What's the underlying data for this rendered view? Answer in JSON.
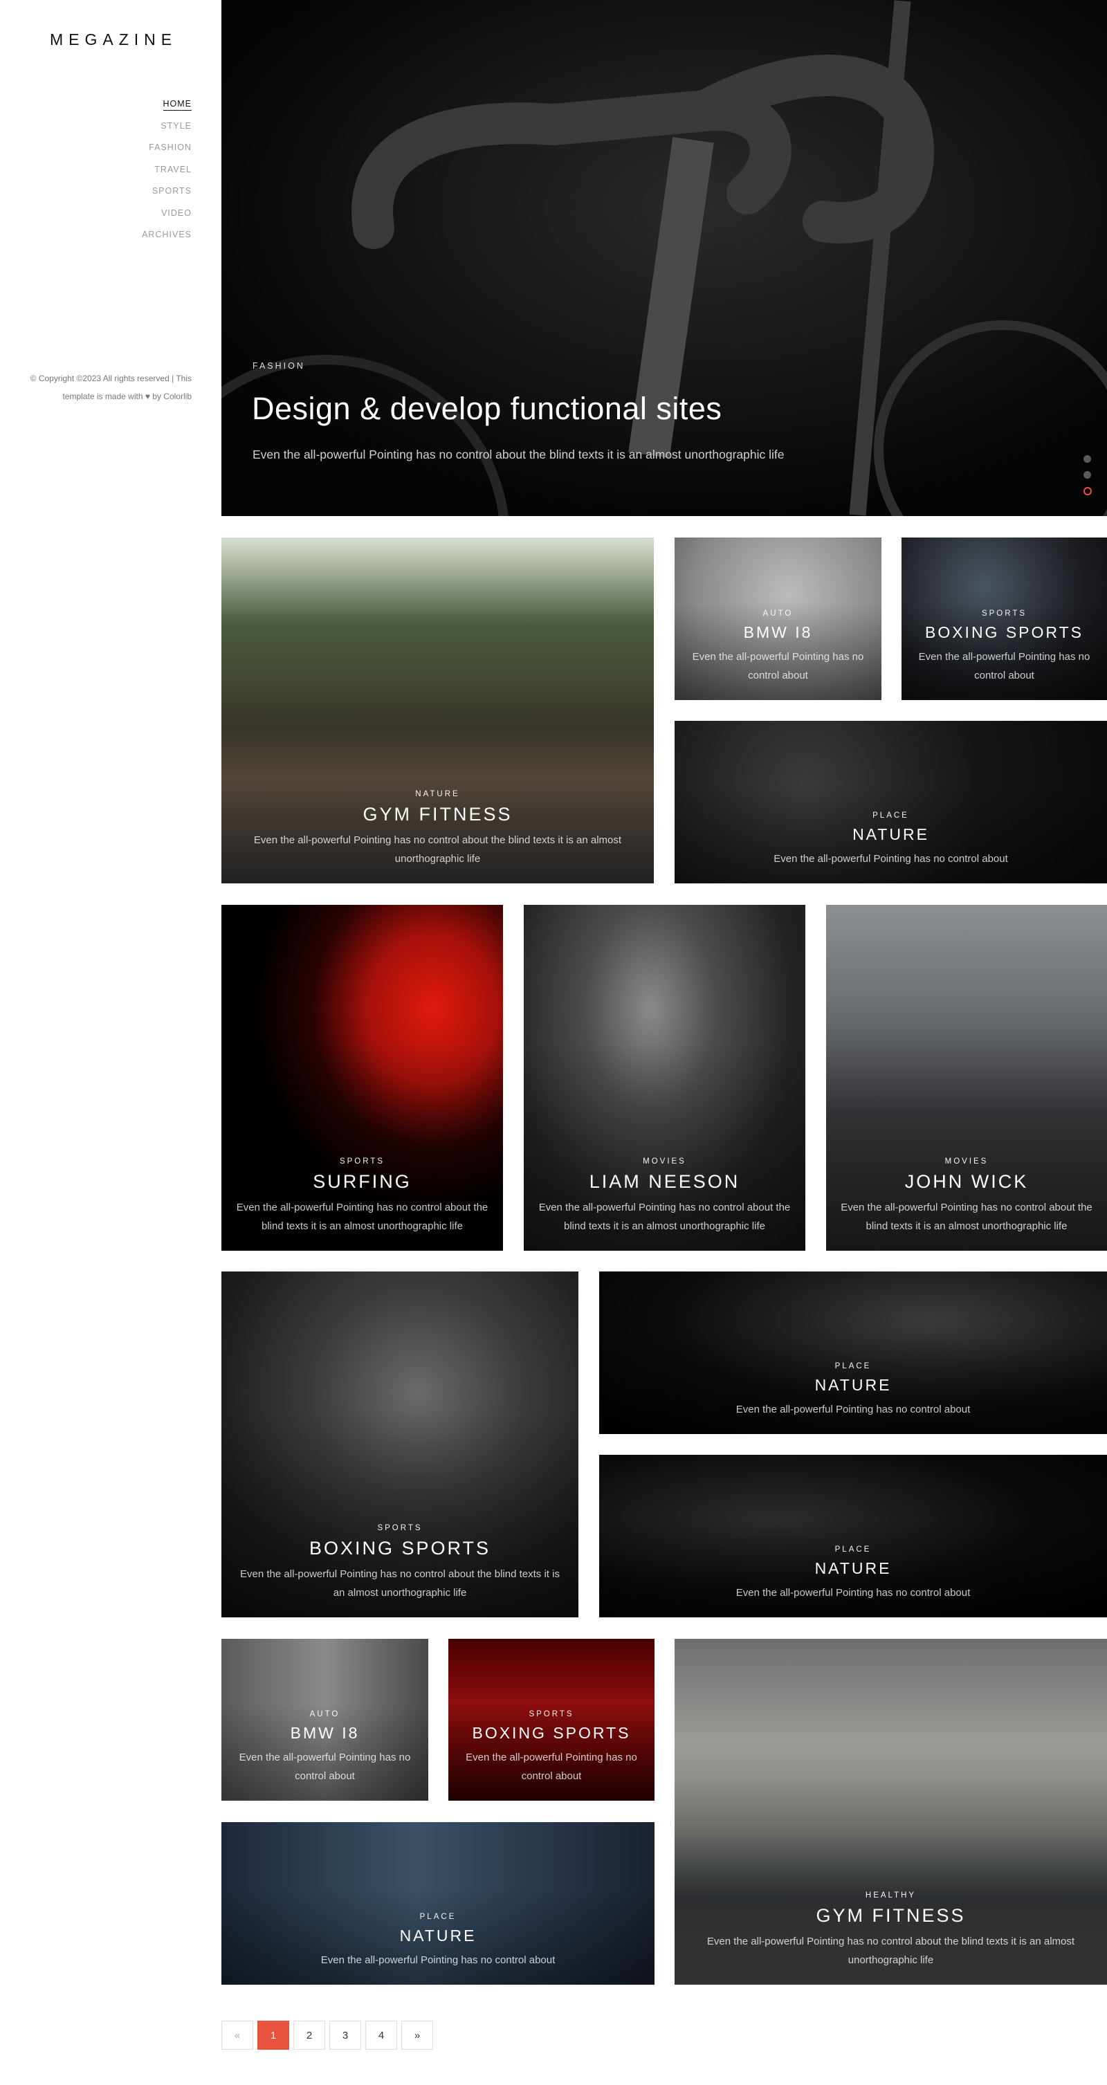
{
  "sidebar": {
    "logo": "MEGAZINE",
    "nav": [
      "HOME",
      "STYLE",
      "FASHION",
      "TRAVEL",
      "SPORTS",
      "VIDEO",
      "ARCHIVES"
    ],
    "copyright": "© Copyright ©2023 All rights reserved | This template is made with ♥ by Colorlib"
  },
  "hero": {
    "category": "FASHION",
    "title": "Design & develop functional sites",
    "subtitle": "Even the all-powerful Pointing has no control about the blind texts it is an almost unorthographic life",
    "slides": 3,
    "active_slide": 3
  },
  "cards": [
    {
      "cat": "NATURE",
      "title": "GYM FITNESS",
      "desc": "Even the all-powerful Pointing has no control about the blind texts it is an almost unorthographic life"
    },
    {
      "cat": "AUTO",
      "title": "BMW I8",
      "desc": "Even the all-powerful Pointing has no control about"
    },
    {
      "cat": "SPORTS",
      "title": "BOXING SPORTS",
      "desc": "Even the all-powerful Pointing has no control about"
    },
    {
      "cat": "PLACE",
      "title": "NATURE",
      "desc": "Even the all-powerful Pointing has no control about"
    },
    {
      "cat": "SPORTS",
      "title": "SURFING",
      "desc": "Even the all-powerful Pointing has no control about the blind texts it is an almost unorthographic life"
    },
    {
      "cat": "MOVIES",
      "title": "LIAM NEESON",
      "desc": "Even the all-powerful Pointing has no control about the blind texts it is an almost unorthographic life"
    },
    {
      "cat": "MOVIES",
      "title": "JOHN WICK",
      "desc": "Even the all-powerful Pointing has no control about the blind texts it is an almost unorthographic life"
    },
    {
      "cat": "SPORTS",
      "title": "BOXING SPORTS",
      "desc": "Even the all-powerful Pointing has no control about the blind texts it is an almost unorthographic life"
    },
    {
      "cat": "PLACE",
      "title": "NATURE",
      "desc": "Even the all-powerful Pointing has no control about"
    },
    {
      "cat": "PLACE",
      "title": "NATURE",
      "desc": "Even the all-powerful Pointing has no control about"
    },
    {
      "cat": "AUTO",
      "title": "BMW I8",
      "desc": "Even the all-powerful Pointing has no control about"
    },
    {
      "cat": "SPORTS",
      "title": "BOXING SPORTS",
      "desc": "Even the all-powerful Pointing has no control about"
    },
    {
      "cat": "HEALTHY",
      "title": "GYM FITNESS",
      "desc": "Even the all-powerful Pointing has no control about the blind texts it is an almost unorthographic life"
    },
    {
      "cat": "PLACE",
      "title": "NATURE",
      "desc": "Even the all-powerful Pointing has no control about"
    }
  ],
  "pagination": {
    "prev": "«",
    "pages": [
      "1",
      "2",
      "3",
      "4"
    ],
    "next": "»",
    "current": "1"
  },
  "colors": {
    "accent": "#e9523f",
    "text": "#111111",
    "muted": "#9a9a9a"
  }
}
